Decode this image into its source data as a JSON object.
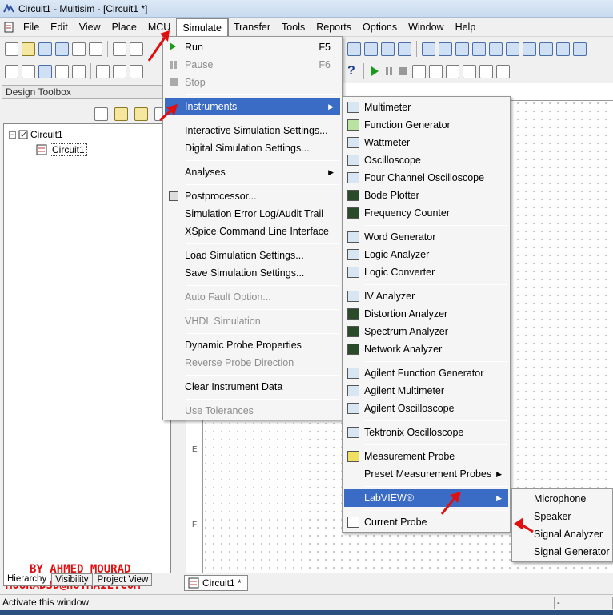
{
  "window": {
    "title": "Circuit1 - Multisim - [Circuit1 *]"
  },
  "menubar": [
    "File",
    "Edit",
    "View",
    "Place",
    "MCU",
    "Simulate",
    "Transfer",
    "Tools",
    "Reports",
    "Options",
    "Window",
    "Help"
  ],
  "simulate_menu": {
    "run": {
      "label": "Run",
      "shortcut": "F5"
    },
    "pause": {
      "label": "Pause",
      "shortcut": "F6"
    },
    "stop": {
      "label": "Stop"
    },
    "instruments": "Instruments",
    "interactive_settings": "Interactive Simulation Settings...",
    "digital_settings": "Digital Simulation Settings...",
    "analyses": "Analyses",
    "postprocessor": "Postprocessor...",
    "error_log": "Simulation Error Log/Audit Trail",
    "xspice": "XSpice Command Line Interface",
    "load_settings": "Load Simulation Settings...",
    "save_settings": "Save Simulation Settings...",
    "auto_fault": "Auto Fault Option...",
    "vhdl": "VHDL Simulation",
    "dynamic_probe": "Dynamic Probe Properties",
    "reverse_probe": "Reverse Probe Direction",
    "clear_data": "Clear Instrument Data",
    "use_tolerances": "Use Tolerances"
  },
  "instruments_menu": {
    "multimeter": "Multimeter",
    "function_generator": "Function Generator",
    "wattmeter": "Wattmeter",
    "oscilloscope": "Oscilloscope",
    "four_channel": "Four Channel Oscilloscope",
    "bode": "Bode Plotter",
    "frequency_counter": "Frequency Counter",
    "word_generator": "Word Generator",
    "logic_analyzer": "Logic Analyzer",
    "logic_converter": "Logic Converter",
    "iv_analyzer": "IV Analyzer",
    "distortion": "Distortion Analyzer",
    "spectrum": "Spectrum Analyzer",
    "network": "Network Analyzer",
    "agilent_fg": "Agilent Function Generator",
    "agilent_mm": "Agilent Multimeter",
    "agilent_osc": "Agilent Oscilloscope",
    "tektronix": "Tektronix Oscilloscope",
    "measurement_probe": "Measurement Probe",
    "preset_probes": "Preset Measurement Probes",
    "labview": "LabVIEW®",
    "current_probe": "Current Probe"
  },
  "labview_menu": [
    "Microphone",
    "Speaker",
    "Signal Analyzer",
    "Signal Generator"
  ],
  "design_toolbox": {
    "title": "Design Toolbox",
    "root": "Circuit1",
    "child": "Circuit1",
    "tabs": [
      "Hierarchy",
      "Visibility",
      "Project View"
    ]
  },
  "ruler_labels": [
    "E",
    "F"
  ],
  "doc_tab": "Circuit1 *",
  "status": {
    "text": "Activate this window",
    "right": "-"
  },
  "watermark": {
    "line1": "BY AHMED MOURAD",
    "line2": "MOURAD3D@HOTMAIL.COM"
  },
  "colors": {
    "highlight": "#3a6cc6",
    "watermark": "#e01010",
    "arrow": "#e01010"
  }
}
